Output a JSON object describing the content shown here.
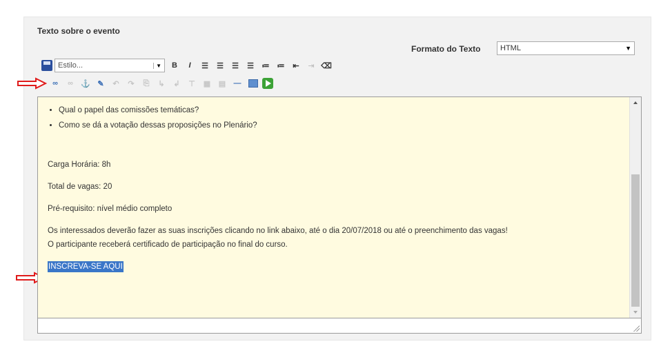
{
  "section": {
    "title": "Texto sobre o evento"
  },
  "format": {
    "label": "Formato do Texto",
    "selected": "HTML"
  },
  "toolbar": {
    "style_placeholder": "Estilo...",
    "row1_icons": [
      "save-icon",
      "bold-icon",
      "italic-icon",
      "align-left-icon",
      "align-center-icon",
      "align-right-icon",
      "justify-icon",
      "bullet-list-icon",
      "numbered-list-icon",
      "outdent-icon",
      "indent-icon",
      "clear-format-icon"
    ],
    "row2_icons": [
      "link-icon",
      "unlink-icon",
      "anchor-icon",
      "edit-icon",
      "undo-icon",
      "redo-icon",
      "table-icon",
      "image-icon",
      "media-icon"
    ]
  },
  "editor": {
    "bullets": [
      "Qual o papel das comissões temáticas?",
      "Como se dá a votação dessas proposições no Plenário?"
    ],
    "carga": "Carga Horária: 8h",
    "vagas": "Total de vagas: 20",
    "prereq": "Pré-requisito: nível médio completo",
    "info_line1": "Os interessados deverão fazer as suas inscrições clicando no link abaixo, até o dia 20/07/2018 ou até o preenchimento das vagas!",
    "info_line2": "O participante receberá certificado de participação no final do curso.",
    "link_text": "INSCREVA-SE AQUI"
  },
  "colors": {
    "editor_bg": "#fffbe0",
    "selection": "#3a76c8",
    "annotation_arrow": "#e01b1b"
  }
}
